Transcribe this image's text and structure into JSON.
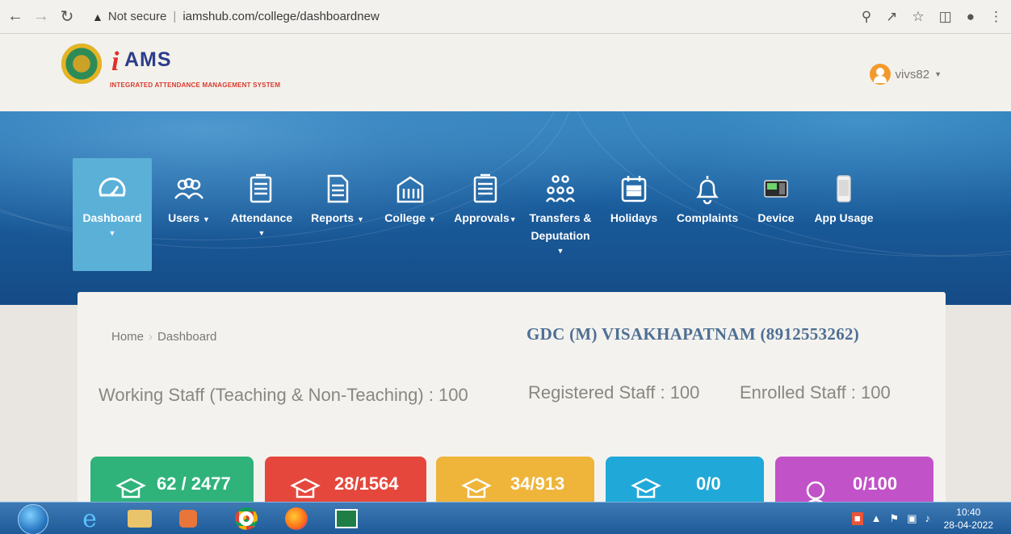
{
  "browser": {
    "security_text": "Not secure",
    "url": "iamshub.com/college/dashboardnew"
  },
  "header": {
    "logo_i": "i",
    "logo_text": "AMS",
    "logo_subtitle": "INTEGRATED ATTENDANCE MANAGEMENT SYSTEM",
    "username": "vivs82"
  },
  "nav": {
    "items": [
      {
        "label": "Dashboard",
        "icon": "gauge-icon",
        "has_dropdown": true,
        "active": true
      },
      {
        "label": "Users",
        "icon": "users-icon",
        "has_dropdown": true
      },
      {
        "label": "Attendance",
        "icon": "register-icon",
        "has_dropdown": true
      },
      {
        "label": "Reports",
        "icon": "document-icon",
        "has_dropdown": true
      },
      {
        "label": "College",
        "icon": "building-icon",
        "has_dropdown": true
      },
      {
        "label": "Approvals",
        "icon": "notepad-icon",
        "has_dropdown": true
      },
      {
        "label": "Transfers &",
        "label2": "Deputation",
        "icon": "people-group-icon",
        "has_dropdown": true
      },
      {
        "label": "Holidays",
        "icon": "calendar-icon"
      },
      {
        "label": "Complaints",
        "icon": "bell-icon"
      },
      {
        "label": "Device",
        "icon": "biometric-device-icon"
      },
      {
        "label": "App Usage",
        "icon": "phone-icon"
      }
    ]
  },
  "main": {
    "breadcrumb": {
      "home": "Home",
      "current": "Dashboard"
    },
    "college_title": "GDC (M) VISAKHAPATNAM (8912553262)",
    "stats": {
      "working": "Working Staff (Teaching & Non-Teaching) : 100",
      "registered": "Registered Staff : 100",
      "enrolled": "Enrolled Staff : 100"
    },
    "tiles": [
      {
        "value": "62 / 2477",
        "color": "#2fb37b",
        "icon": "teacher-icon"
      },
      {
        "value": "28/1564",
        "color": "#e5473d",
        "icon": "teacher-icon"
      },
      {
        "value": "34/913",
        "color": "#efb43a",
        "icon": "teacher-icon"
      },
      {
        "value": "0/0",
        "color": "#20a8d8",
        "icon": "teacher-icon"
      },
      {
        "value": "0/100",
        "color": "#c252c8",
        "icon": "person-icon"
      }
    ]
  },
  "taskbar": {
    "time": "10:40",
    "date": "28-04-2022"
  }
}
